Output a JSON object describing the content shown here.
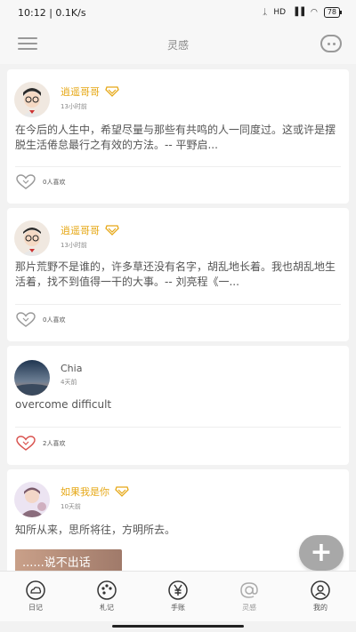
{
  "status": {
    "time_speed": "10:12 | 0.1K/s",
    "signal_text": "HD",
    "battery": "78"
  },
  "appbar": {
    "title": "灵感"
  },
  "posts": [
    {
      "author": "逍遥哥哥",
      "vip": true,
      "time": "13小时前",
      "content": "在今后的人生中，希望尽量与那些有共鸣的人一同度过。这或许是摆脱生活倦怠最行之有效的方法。-- 平野启...",
      "likes": "0人喜欢",
      "liked": false
    },
    {
      "author": "逍遥哥哥",
      "vip": true,
      "time": "13小时前",
      "content": "那片荒野不是谁的，许多草还没有名字，胡乱地长着。我也胡乱地生活着，找不到值得一干的大事。-- 刘亮程《一...",
      "likes": "0人喜欢",
      "liked": false
    },
    {
      "author": "Chia",
      "vip": false,
      "time": "4天前",
      "content": "overcome difficult",
      "likes": "2人喜欢",
      "liked": true
    },
    {
      "author": "如果我是你",
      "vip": true,
      "time": "10天前",
      "content": "知所从来，思所将往，方明所去。",
      "image_text": "......说不出话"
    }
  ],
  "fab_label": "+",
  "nav": [
    {
      "label": "日记",
      "icon": "cloud-icon"
    },
    {
      "label": "札记",
      "icon": "palette-icon"
    },
    {
      "label": "手账",
      "icon": "yen-icon"
    },
    {
      "label": "灵感",
      "icon": "at-icon"
    },
    {
      "label": "我的",
      "icon": "profile-icon"
    }
  ],
  "colors": {
    "accent_name": "#e6a817",
    "liked_heart": "#d9534f",
    "fab": "#a8a8a8"
  }
}
